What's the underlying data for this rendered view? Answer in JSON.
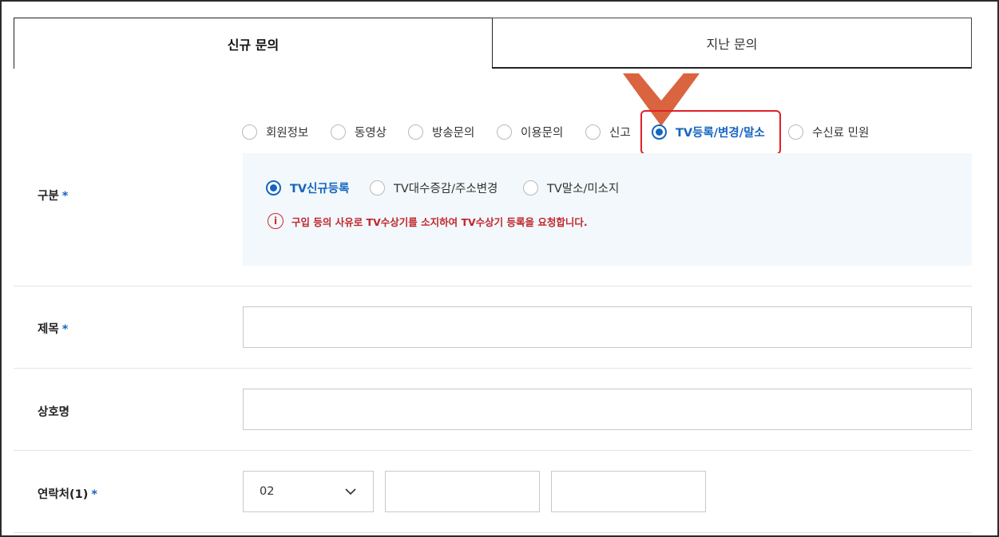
{
  "tabs": [
    {
      "label": "신규 문의",
      "active": true
    },
    {
      "label": "지난 문의",
      "active": false
    }
  ],
  "category": {
    "label": "구분",
    "required_mark": "*",
    "options": [
      "회원정보",
      "동영상",
      "방송문의",
      "이용문의",
      "신고",
      "TV등록/변경/말소",
      "수신료 민원"
    ],
    "selected": "TV등록/변경/말소",
    "sub_options": [
      "TV신규등록",
      "TV대수증감/주소변경",
      "TV말소/미소지"
    ],
    "sub_selected": "TV신규등록",
    "notice": "구입 등의 사유로 TV수상기를 소지하여 TV수상기 등록을 요청합니다."
  },
  "title_field": {
    "label": "제목",
    "required_mark": "*",
    "value": ""
  },
  "company_field": {
    "label": "상호명",
    "value": ""
  },
  "contact_field": {
    "label": "연락처(1)",
    "required_mark": "*",
    "area_code": "02",
    "middle": "",
    "last": ""
  },
  "colors": {
    "accent": "#1565c0",
    "highlight": "#e0202a",
    "arrow": "#d9643f",
    "notice": "#c0272d",
    "subbox_bg": "#f2f8fb"
  },
  "icons": {
    "notice": "info-circle-icon",
    "select": "chevron-down-icon",
    "pointer": "down-arrow-icon"
  }
}
